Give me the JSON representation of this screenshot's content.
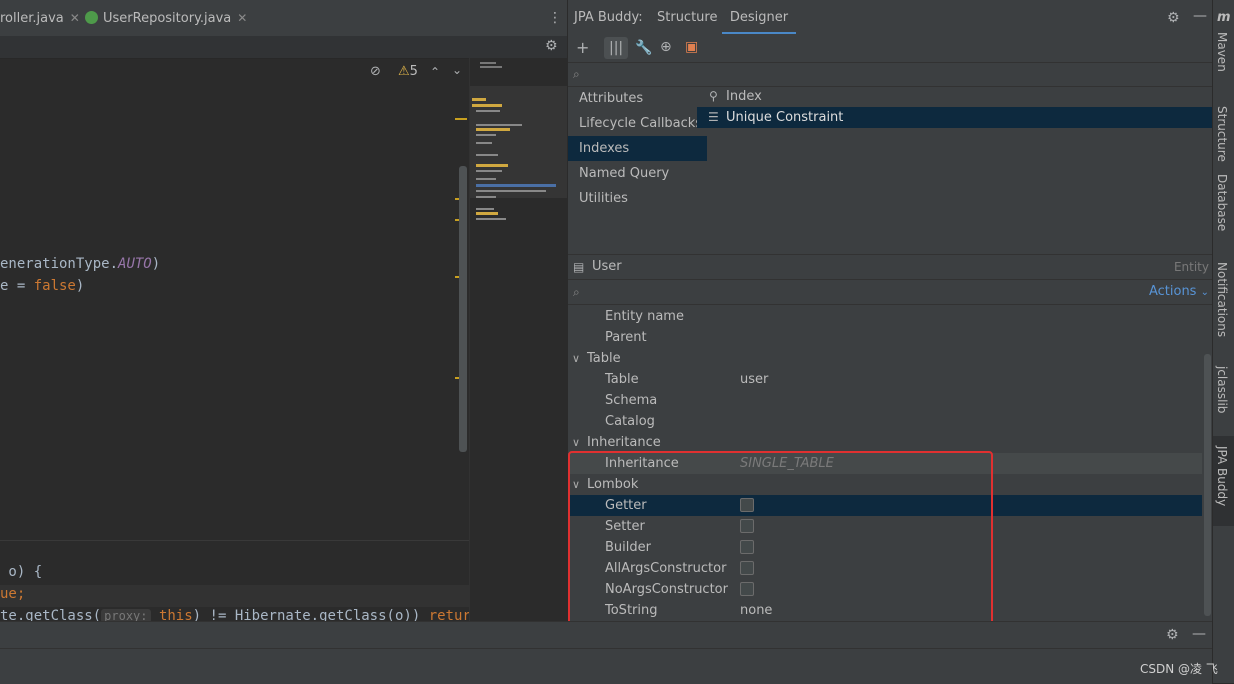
{
  "editor": {
    "tabs": [
      {
        "label": "roller.java"
      },
      {
        "label": "UserRepository.java"
      }
    ],
    "tab_close": "✕",
    "warnings_count": "5",
    "code_lines": {
      "line1_a": "enerationType.",
      "line1_b": "AUTO",
      "line1_c": ")",
      "line2_a": "e = ",
      "line2_b": "false",
      "line2_c": ")",
      "line3": " o) {",
      "line4": "ue;",
      "line5_a": "te.getClass(",
      "line5_hint": "proxy:",
      "line5_b": " this",
      "line5_c": ") != Hibernate.getClass(o)) ",
      "line5_d": "return fa"
    }
  },
  "jpa": {
    "title": "JPA Buddy:",
    "tabs": [
      {
        "label": "Structure"
      },
      {
        "label": "Designer"
      }
    ],
    "nav": [
      {
        "label": "Attributes"
      },
      {
        "label": "Lifecycle Callbacks"
      },
      {
        "label": "Indexes"
      },
      {
        "label": "Named Query"
      },
      {
        "label": "Utilities"
      }
    ],
    "indexes": [
      {
        "label": "Index"
      },
      {
        "label": "Unique Constraint"
      }
    ],
    "entity": {
      "name": "User",
      "kind": "Entity"
    },
    "actions_label": "Actions",
    "properties": [
      {
        "label": "Entity name",
        "value": ""
      },
      {
        "label": "Parent",
        "value": ""
      },
      {
        "label": "Table",
        "value": ""
      },
      {
        "label": "Table",
        "value": "user"
      },
      {
        "label": "Schema",
        "value": ""
      },
      {
        "label": "Catalog",
        "value": ""
      },
      {
        "label": "Inheritance",
        "value": ""
      },
      {
        "label": "Inheritance",
        "value": "SINGLE_TABLE"
      },
      {
        "label": "Lombok",
        "value": ""
      },
      {
        "label": "Getter",
        "value": ""
      },
      {
        "label": "Setter",
        "value": ""
      },
      {
        "label": "Builder",
        "value": ""
      },
      {
        "label": "AllArgsConstructor",
        "value": ""
      },
      {
        "label": "NoArgsConstructor",
        "value": ""
      },
      {
        "label": "ToString",
        "value": "none"
      }
    ]
  },
  "sidebar_strip": {
    "maven_logo": "m",
    "items": [
      {
        "label": "Maven"
      },
      {
        "label": "Structure"
      },
      {
        "label": "Database"
      },
      {
        "label": "Notifications"
      },
      {
        "label": "jclasslib"
      },
      {
        "label": "JPA Buddy"
      }
    ]
  },
  "watermark": "CSDN @凌 飞"
}
